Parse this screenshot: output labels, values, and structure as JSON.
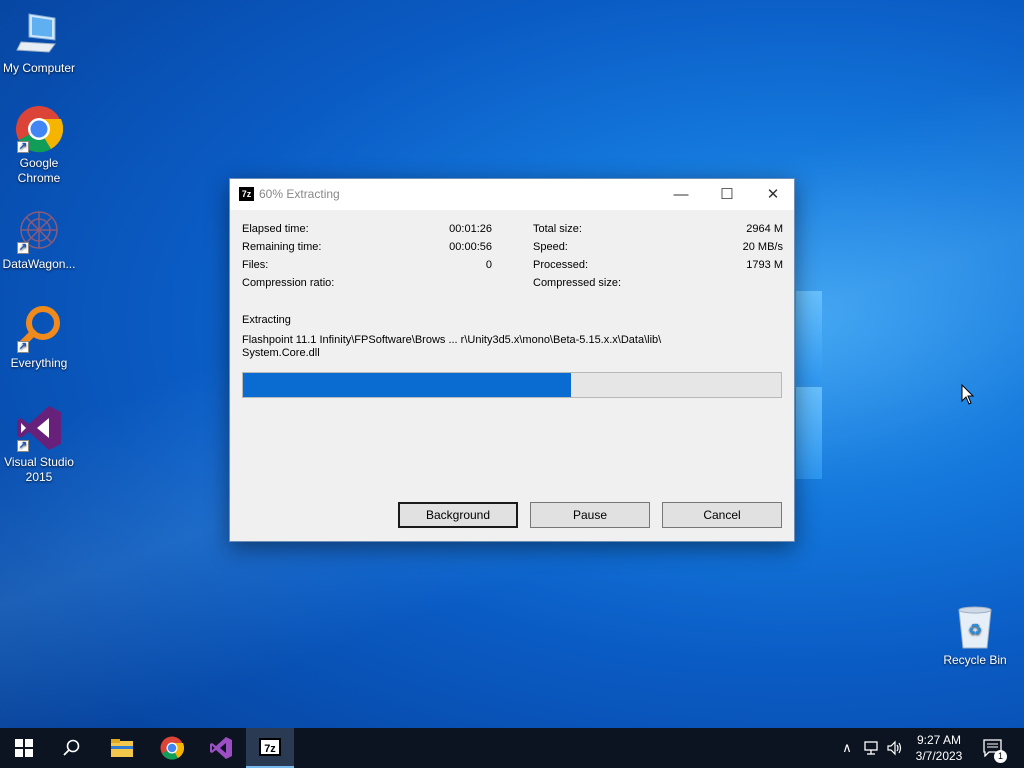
{
  "desktop": {
    "icons": [
      {
        "label": "My Computer"
      },
      {
        "label": "Google Chrome"
      },
      {
        "label": "DataWagon..."
      },
      {
        "label": "Everything"
      },
      {
        "label": "Visual Studio 2015"
      },
      {
        "label": "Recycle Bin"
      }
    ]
  },
  "dialog": {
    "app_icon": "7z",
    "title": "60% Extracting",
    "controls": {
      "minimize": "—",
      "maximize": "☐",
      "close": "✕"
    },
    "stats_left": [
      {
        "label": "Elapsed time:",
        "value": "00:01:26"
      },
      {
        "label": "Remaining time:",
        "value": "00:00:56"
      },
      {
        "label": "Files:",
        "value": "0"
      },
      {
        "label": "Compression ratio:",
        "value": ""
      }
    ],
    "stats_right": [
      {
        "label": "Total size:",
        "value": "2964 M"
      },
      {
        "label": "Speed:",
        "value": "20 MB/s"
      },
      {
        "label": "Processed:",
        "value": "1793 M"
      },
      {
        "label": "Compressed size:",
        "value": ""
      }
    ],
    "operation": "Extracting",
    "path_line1": "Flashpoint 11.1 Infinity\\FPSoftware\\Brows ... r\\Unity3d5.x\\mono\\Beta-5.15.x.x\\Data\\lib\\",
    "path_line2": "System.Core.dll",
    "progress_percent": 61,
    "buttons": {
      "background": "Background",
      "pause": "Pause",
      "cancel": "Cancel"
    }
  },
  "taskbar": {
    "apps": [
      "start-icon",
      "search-icon",
      "file-explorer-icon",
      "chrome-icon",
      "visual-studio-icon",
      "7zip-icon"
    ],
    "app_7z_label": "7z",
    "tray": {
      "chevron": "∧",
      "network": "🖧",
      "volume": "🔈"
    },
    "time": "9:27 AM",
    "date": "3/7/2023",
    "notification_count": "1"
  },
  "colors": {
    "accent": "#0a6cd0",
    "taskbar": "#0c1422"
  }
}
